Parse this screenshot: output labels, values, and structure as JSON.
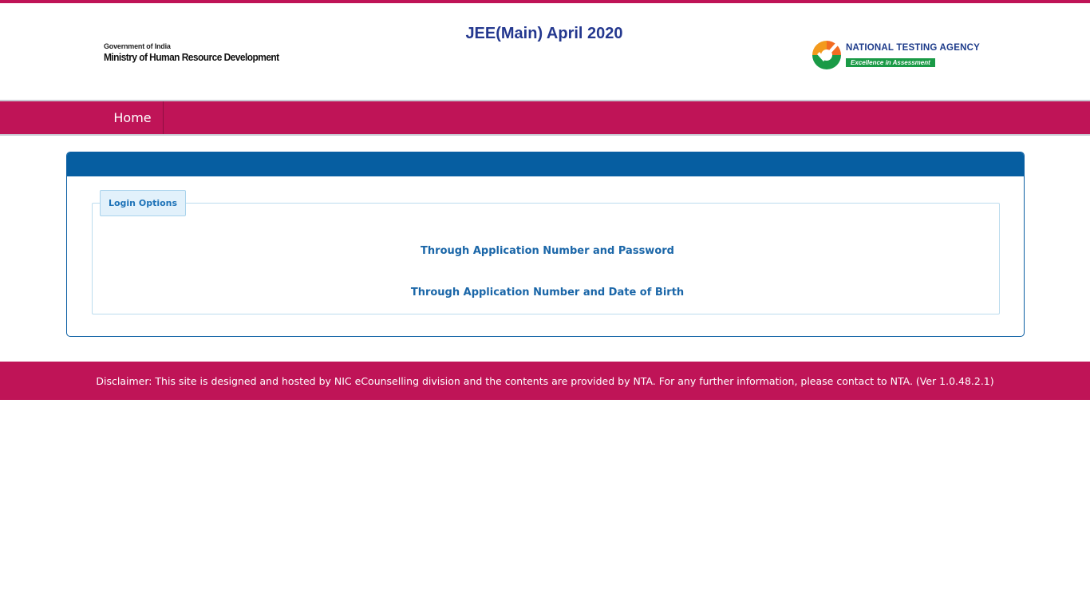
{
  "header": {
    "title": "JEE(Main) April 2020",
    "mhrd": {
      "line1": "Government of India",
      "line2": "Ministry of Human Resource Development",
      "icon": "national-emblem-icon"
    },
    "nta": {
      "name": "NATIONAL TESTING AGENCY",
      "tagline": "Excellence in Assessment",
      "icon": "nta-check-icon"
    }
  },
  "nav": {
    "home_label": "Home"
  },
  "login": {
    "legend": "Login Options",
    "options": [
      "Through Application Number and Password",
      "Through Application Number and Date of Birth"
    ]
  },
  "footer": {
    "disclaimer": "Disclaimer: This site is designed and hosted by NIC eCounselling division and the contents are provided by NTA. For any further information, please contact to NTA. (Ver 1.0.48.2.1)"
  },
  "colors": {
    "brand": "#bf1457",
    "panel_header": "#065ea1",
    "title": "#24388f",
    "link": "#1a66a8"
  }
}
